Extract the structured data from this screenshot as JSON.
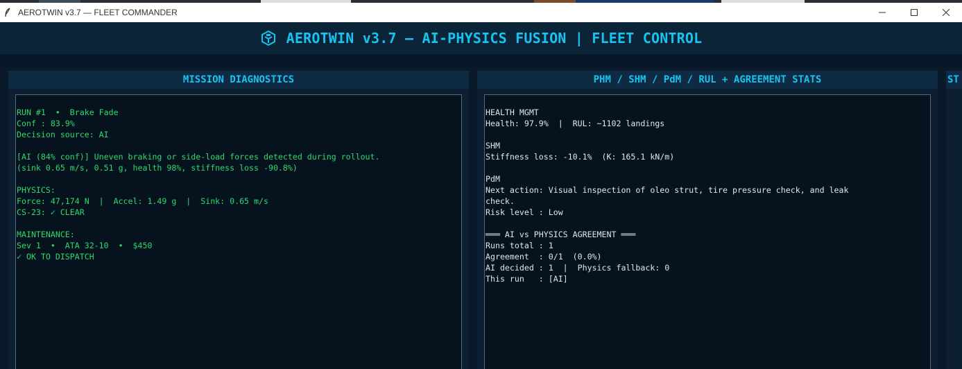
{
  "window": {
    "title": "AEROTWIN v3.7 — FLEET COMMANDER",
    "minimize_glyph": "—",
    "maximize_glyph": "☐",
    "close_glyph": "✕",
    "app_icon": "feather-icon"
  },
  "header": {
    "title": "AEROTWIN v3.7 — AI-PHYSICS FUSION | FLEET CONTROL",
    "logo_icon": "cube-logo-icon",
    "accent_color": "#19c3f0"
  },
  "panels": {
    "mission": {
      "title": "MISSION DIAGNOSTICS",
      "lines": [
        "RUN #1  •  Brake Fade",
        "Conf : 83.9%",
        "Decision source: AI",
        "",
        "[AI (84% conf)] Uneven braking or side-load forces detected during rollout.",
        "(sink 0.65 m/s, 0.51 g, health 98%, stiffness loss -90.8%)",
        "",
        "PHYSICS:",
        "Force: 47,174 N  |  Accel: 1.49 g  |  Sink: 0.65 m/s",
        "CS-23: ✓ CLEAR",
        "",
        "MAINTENANCE:",
        "Sev 1  •  ATA 32-10  •  $450",
        "✓ OK TO DISPATCH"
      ],
      "text_color": "#2ed96b"
    },
    "phm": {
      "title": "PHM / SHM / PdM / RUL  +  AGREEMENT STATS",
      "lines": [
        "HEALTH MGMT",
        "Health: 97.9%  |  RUL: ~1102 landings",
        "",
        "SHM",
        "Stiffness loss: -10.1%  (K: 165.1 kN/m)",
        "",
        "PdM",
        "Next action: Visual inspection of oleo strut, tire pressure check, and leak",
        "check.",
        "Risk level : Low",
        "",
        "═══ AI vs PHYSICS AGREEMENT ═══",
        "Runs total : 1",
        "Agreement  : 0/1  (0.0%)",
        "AI decided : 1  |  Physics fallback: 0",
        "This run   : [AI]"
      ],
      "text_color": "#e0e6ec"
    },
    "third": {
      "title": "ST"
    }
  }
}
